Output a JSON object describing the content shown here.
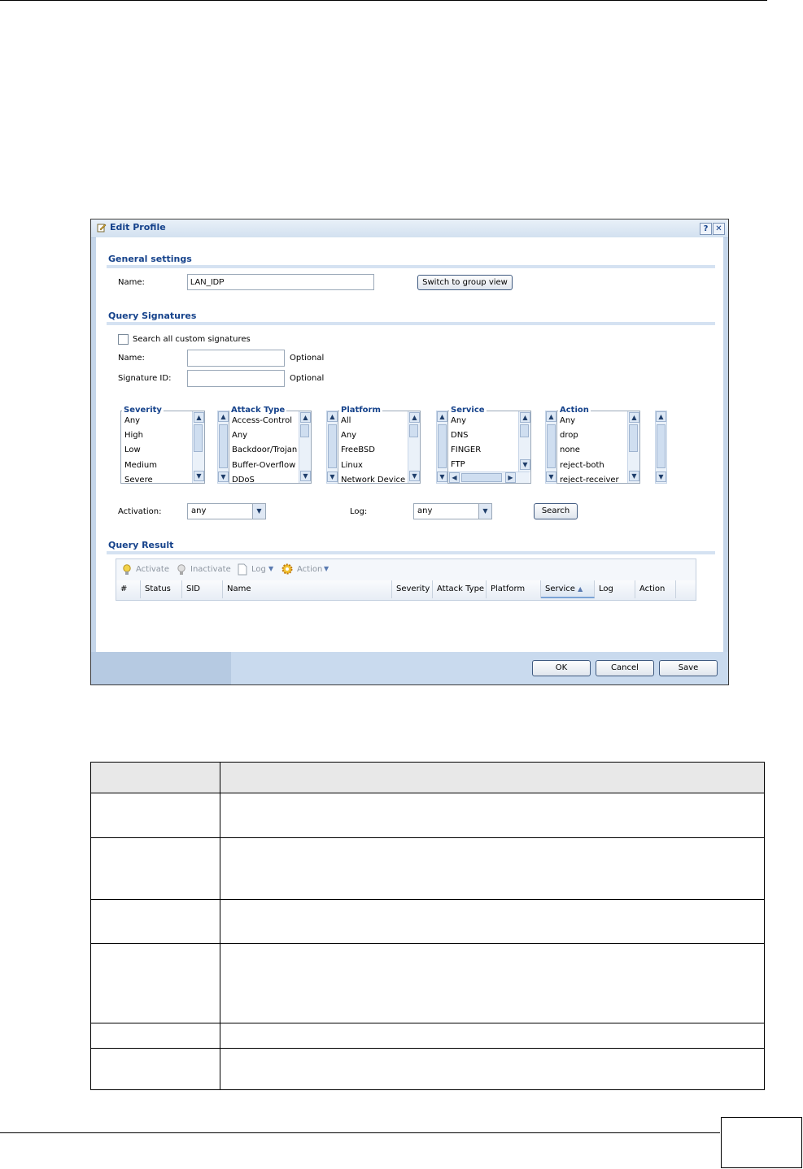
{
  "window": {
    "title": "Edit Profile",
    "help_label": "?",
    "close_label": "✕"
  },
  "general": {
    "heading": "General settings",
    "name_label": "Name:",
    "name_value": "LAN_IDP",
    "switch_button": "Switch to group view"
  },
  "query": {
    "heading": "Query Signatures",
    "search_custom_label": "Search all custom signatures",
    "name_label": "Name:",
    "name_hint": "Optional",
    "sigid_label": "Signature ID:",
    "sigid_hint": "Optional",
    "severity": {
      "title": "Severity",
      "items": [
        "Any",
        "High",
        "Low",
        "Medium",
        "Severe"
      ]
    },
    "attack_type": {
      "title": "Attack Type",
      "items": [
        "Access-Control",
        "Any",
        "Backdoor/Trojan",
        "Buffer-Overflow",
        "DDoS"
      ]
    },
    "platform": {
      "title": "Platform",
      "items": [
        "All",
        "Any",
        "FreeBSD",
        "Linux",
        "Network Device"
      ]
    },
    "service": {
      "title": "Service",
      "items": [
        "Any",
        "DNS",
        "FINGER",
        "FTP"
      ]
    },
    "action": {
      "title": "Action",
      "items": [
        "Any",
        "drop",
        "none",
        "reject-both",
        "reject-receiver"
      ]
    },
    "activation_label": "Activation:",
    "activation_value": "any",
    "log_label": "Log:",
    "log_value": "any",
    "search_button": "Search"
  },
  "result": {
    "heading": "Query Result",
    "toolbar": {
      "activate": "Activate",
      "inactivate": "Inactivate",
      "log": "Log",
      "action": "Action"
    },
    "columns": [
      "#",
      "Status",
      "SID",
      "Name",
      "Severity",
      "Attack Type",
      "Platform",
      "Service",
      "Log",
      "Action"
    ]
  },
  "footer": {
    "ok": "OK",
    "cancel": "Cancel",
    "save": "Save"
  },
  "colors": {
    "title_text": "#15428b",
    "window_frame": "#c5d6ea"
  },
  "icons": [
    "edit-icon",
    "help-icon",
    "close-icon",
    "bulb-icon",
    "document-icon",
    "gear-icon",
    "sort-ascending-icon",
    "chevron-down-icon"
  ]
}
